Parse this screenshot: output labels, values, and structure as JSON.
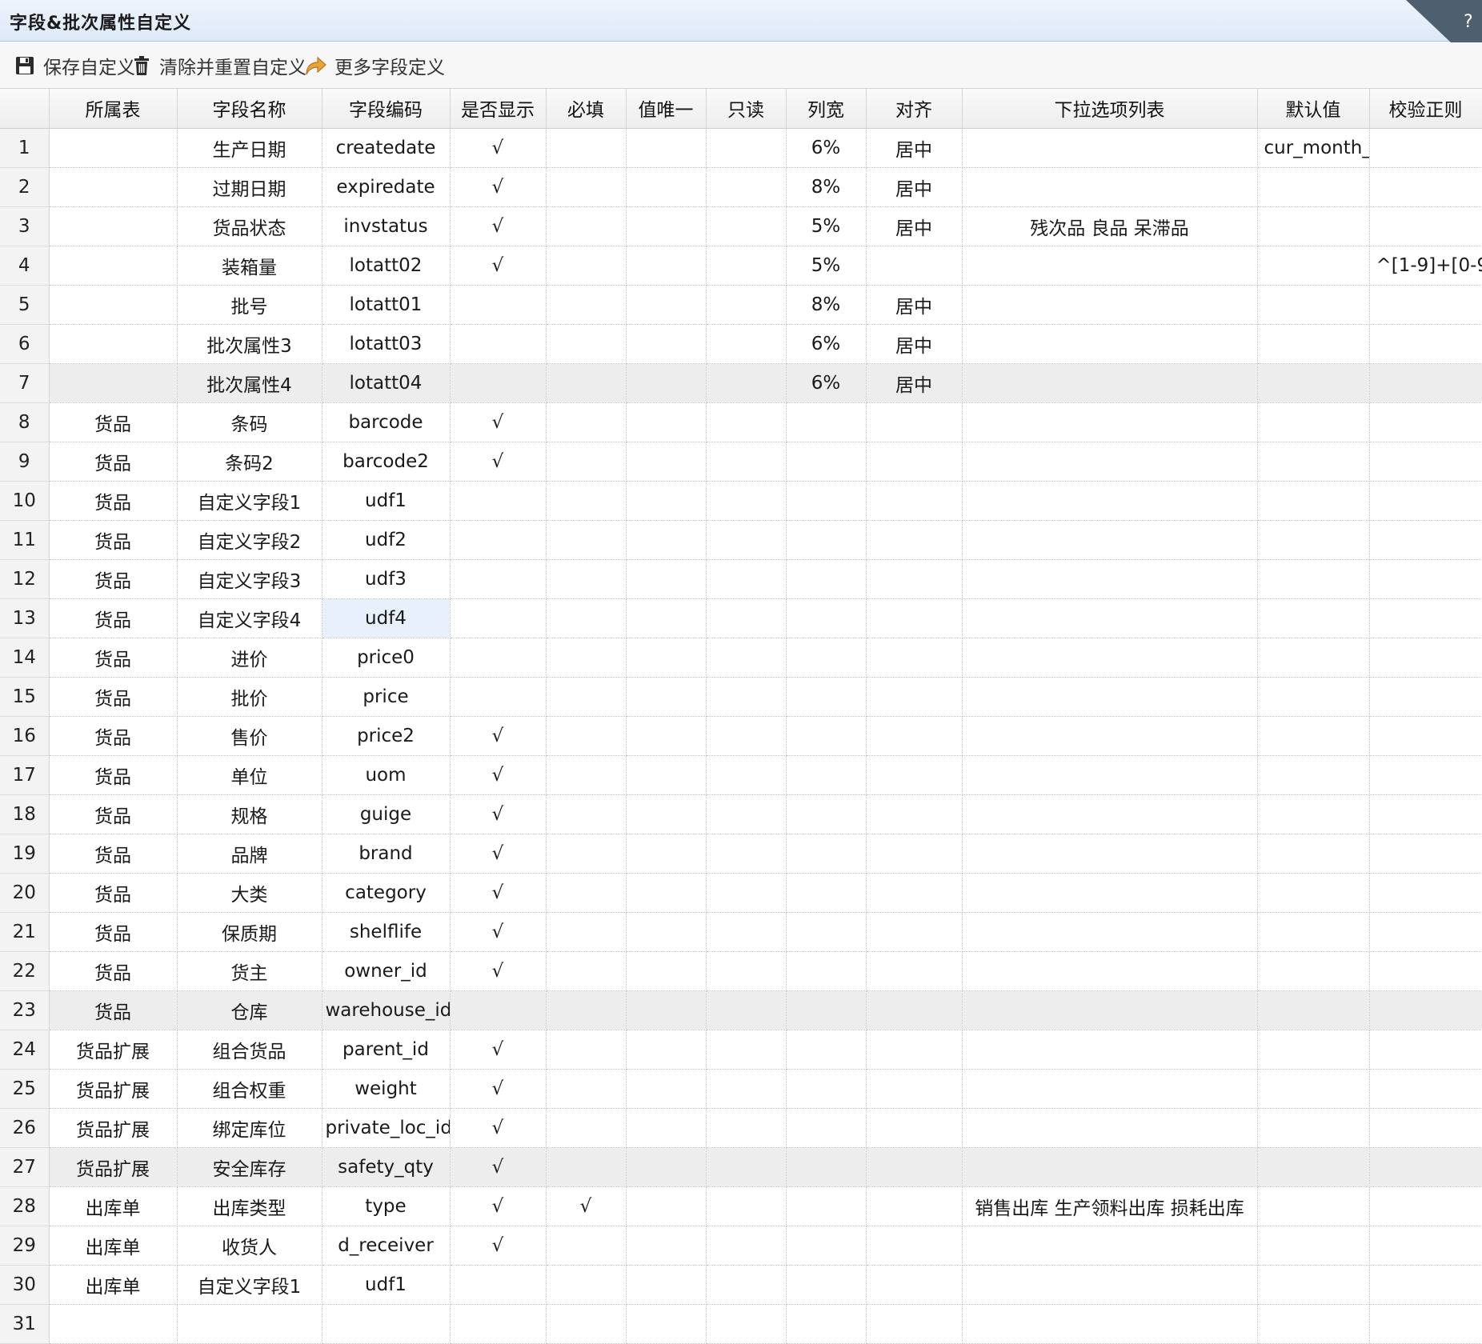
{
  "window": {
    "title": "字段&批次属性自定义"
  },
  "toolbar": {
    "save_label": "保存自定义",
    "clear_label": "清除并重置自定义",
    "more_label": "更多字段定义"
  },
  "grid": {
    "columns": [
      "",
      "所属表",
      "字段名称",
      "字段编码",
      "是否显示",
      "必填",
      "值唯一",
      "只读",
      "列宽",
      "对齐",
      "下拉选项列表",
      "默认值",
      "校验正则"
    ],
    "rows": [
      [
        "1",
        "",
        "生产日期",
        "createdate",
        "√",
        "",
        "",
        "",
        "6%",
        "居中",
        "",
        "cur_month_(",
        ""
      ],
      [
        "2",
        "",
        "过期日期",
        "expiredate",
        "√",
        "",
        "",
        "",
        "8%",
        "居中",
        "",
        "",
        ""
      ],
      [
        "3",
        "",
        "货品状态",
        "invstatus",
        "√",
        "",
        "",
        "",
        "5%",
        "居中",
        "残次品 良品 呆滞品",
        "",
        ""
      ],
      [
        "4",
        "",
        "装箱量",
        "lotatt02",
        "√",
        "",
        "",
        "",
        "5%",
        "",
        "",
        "",
        "^[1-9]+[0-9"
      ],
      [
        "5",
        "",
        "批号",
        "lotatt01",
        "",
        "",
        "",
        "",
        "8%",
        "居中",
        "",
        "",
        ""
      ],
      [
        "6",
        "",
        "批次属性3",
        "lotatt03",
        "",
        "",
        "",
        "",
        "6%",
        "居中",
        "",
        "",
        ""
      ],
      [
        "7",
        "",
        "批次属性4",
        "lotatt04",
        "",
        "",
        "",
        "",
        "6%",
        "居中",
        "",
        "",
        ""
      ],
      [
        "8",
        "货品",
        "条码",
        "barcode",
        "√",
        "",
        "",
        "",
        "",
        "",
        "",
        "",
        ""
      ],
      [
        "9",
        "货品",
        "条码2",
        "barcode2",
        "√",
        "",
        "",
        "",
        "",
        "",
        "",
        "",
        ""
      ],
      [
        "10",
        "货品",
        "自定义字段1",
        "udf1",
        "",
        "",
        "",
        "",
        "",
        "",
        "",
        "",
        ""
      ],
      [
        "11",
        "货品",
        "自定义字段2",
        "udf2",
        "",
        "",
        "",
        "",
        "",
        "",
        "",
        "",
        ""
      ],
      [
        "12",
        "货品",
        "自定义字段3",
        "udf3",
        "",
        "",
        "",
        "",
        "",
        "",
        "",
        "",
        ""
      ],
      [
        "13",
        "货品",
        "自定义字段4",
        "udf4",
        "",
        "",
        "",
        "",
        "",
        "",
        "",
        "",
        ""
      ],
      [
        "14",
        "货品",
        "进价",
        "price0",
        "",
        "",
        "",
        "",
        "",
        "",
        "",
        "",
        ""
      ],
      [
        "15",
        "货品",
        "批价",
        "price",
        "",
        "",
        "",
        "",
        "",
        "",
        "",
        "",
        ""
      ],
      [
        "16",
        "货品",
        "售价",
        "price2",
        "√",
        "",
        "",
        "",
        "",
        "",
        "",
        "",
        ""
      ],
      [
        "17",
        "货品",
        "单位",
        "uom",
        "√",
        "",
        "",
        "",
        "",
        "",
        "",
        "",
        ""
      ],
      [
        "18",
        "货品",
        "规格",
        "guige",
        "√",
        "",
        "",
        "",
        "",
        "",
        "",
        "",
        ""
      ],
      [
        "19",
        "货品",
        "品牌",
        "brand",
        "√",
        "",
        "",
        "",
        "",
        "",
        "",
        "",
        ""
      ],
      [
        "20",
        "货品",
        "大类",
        "category",
        "√",
        "",
        "",
        "",
        "",
        "",
        "",
        "",
        ""
      ],
      [
        "21",
        "货品",
        "保质期",
        "shelflife",
        "√",
        "",
        "",
        "",
        "",
        "",
        "",
        "",
        ""
      ],
      [
        "22",
        "货品",
        "货主",
        "owner_id",
        "√",
        "",
        "",
        "",
        "",
        "",
        "",
        "",
        ""
      ],
      [
        "23",
        "货品",
        "仓库",
        "warehouse_id",
        "",
        "",
        "",
        "",
        "",
        "",
        "",
        "",
        ""
      ],
      [
        "24",
        "货品扩展",
        "组合货品",
        "parent_id",
        "√",
        "",
        "",
        "",
        "",
        "",
        "",
        "",
        ""
      ],
      [
        "25",
        "货品扩展",
        "组合权重",
        "weight",
        "√",
        "",
        "",
        "",
        "",
        "",
        "",
        "",
        ""
      ],
      [
        "26",
        "货品扩展",
        "绑定库位",
        "private_loc_id",
        "√",
        "",
        "",
        "",
        "",
        "",
        "",
        "",
        ""
      ],
      [
        "27",
        "货品扩展",
        "安全库存",
        "safety_qty",
        "√",
        "",
        "",
        "",
        "",
        "",
        "",
        "",
        ""
      ],
      [
        "28",
        "出库单",
        "出库类型",
        "type",
        "√",
        "√",
        "",
        "",
        "",
        "",
        "销售出库 生产领料出库 损耗出库",
        "",
        ""
      ],
      [
        "29",
        "出库单",
        "收货人",
        "d_receiver",
        "√",
        "",
        "",
        "",
        "",
        "",
        "",
        "",
        ""
      ],
      [
        "30",
        "出库单",
        "自定义字段1",
        "udf1",
        "",
        "",
        "",
        "",
        "",
        "",
        "",
        "",
        ""
      ],
      [
        "31",
        "",
        "",
        "",
        "",
        "",
        "",
        "",
        "",
        "",
        "",
        "",
        ""
      ]
    ]
  },
  "icons": {
    "save": "save-icon",
    "clear": "trash-icon",
    "more": "share-arrow-icon",
    "corner": "corner-tab-icon"
  },
  "colors": {
    "title_bg": "#dde9f8",
    "header_bg": "#ededed",
    "alt_row": "#ededed",
    "selected_cell": "#e7f0fb"
  }
}
